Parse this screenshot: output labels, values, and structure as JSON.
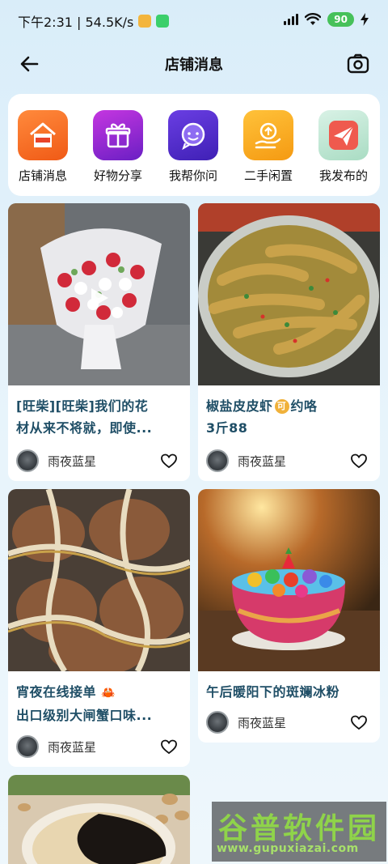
{
  "status_bar": {
    "time_speed": "下午2:31 | 54.5K/s",
    "battery": "90"
  },
  "header": {
    "title": "店铺消息"
  },
  "categories": [
    {
      "label": "店铺消息",
      "icon": "shop-news-icon",
      "color": "#f06a22"
    },
    {
      "label": "好物分享",
      "icon": "gift-icon",
      "color": "#8b2fd6"
    },
    {
      "label": "我帮你问",
      "icon": "chat-help-icon",
      "color": "#5a2ed1"
    },
    {
      "label": "二手闲置",
      "icon": "recycle-hand-icon",
      "color": "#f2a51c"
    },
    {
      "label": "我发布的",
      "icon": "paper-plane-icon",
      "color": "#e8574c"
    }
  ],
  "feed": [
    {
      "title_line1": "[旺柴][旺柴]我们的花",
      "title_line2": "材从来不将就，即使...",
      "user": "雨夜蓝星"
    },
    {
      "title_line1": "椒盐皮皮虾",
      "title_mid": "可",
      "title_after": "约咯",
      "title_line2": "3斤88",
      "user": "雨夜蓝星"
    },
    {
      "title_line1": "宵夜在线接单",
      "title_line2": "出口级别大闸蟹口味...",
      "user": "雨夜蓝星"
    },
    {
      "title_line1": "午后暖阳下的斑斓冰粉",
      "user": "雨夜蓝星"
    }
  ],
  "watermark": {
    "top": "谷普软件园",
    "bottom": "www.gupuxiazai.com"
  },
  "colors": {
    "accent_title": "#1f4e66",
    "background": "#e3f1fa"
  }
}
